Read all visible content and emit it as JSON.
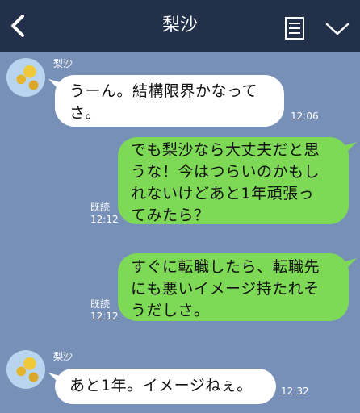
{
  "header": {
    "title": "梨沙",
    "back_icon": "chevron-left-icon",
    "menu_icon": "document-icon",
    "expand_icon": "chevron-down-icon"
  },
  "colors": {
    "background": "#7790b8",
    "header": "#23304a",
    "sent_bubble": "#7ed957",
    "received_bubble": "#ffffff"
  },
  "messages": [
    {
      "sender": "梨沙",
      "lines": [
        "うーん。結構限界かなって",
        "さ。"
      ],
      "time": "12:06"
    },
    {
      "lines": [
        "でも梨沙なら大丈夫だと思",
        "うな！今はつらいのかもし",
        "れないけどあと1年頑張っ",
        "てみたら？"
      ],
      "read": "既読",
      "time": "12:12"
    },
    {
      "lines": [
        "すぐに転職したら、転職先",
        "にも悪いイメージ持たれそ",
        "うだしさ。"
      ],
      "read": "既読",
      "time": "12:12"
    },
    {
      "sender": "梨沙",
      "lines": [
        "あと1年。イメージねぇ。"
      ],
      "time": "12:32"
    }
  ]
}
